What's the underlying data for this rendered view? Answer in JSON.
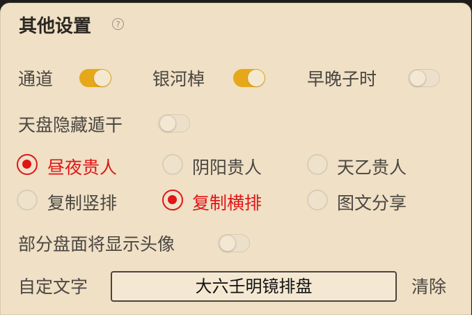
{
  "section": {
    "title": "其他设置",
    "help_icon": "?"
  },
  "toggles_row1": [
    {
      "label": "通道",
      "on": true
    },
    {
      "label": "银河棹",
      "on": true
    },
    {
      "label": "早晚子时",
      "on": false
    }
  ],
  "toggle_tianpan": {
    "label": "天盘隐藏遁干",
    "on": false
  },
  "radio_group1": {
    "options": [
      "昼夜贵人",
      "阴阳贵人",
      "天乙贵人"
    ],
    "selected": "昼夜贵人"
  },
  "radio_group2": {
    "options": [
      "复制竖排",
      "复制横排",
      "图文分享"
    ],
    "selected": "复制横排"
  },
  "toggle_avatar": {
    "label": "部分盘面将显示头像",
    "on": false
  },
  "custom_text": {
    "label": "自定文字",
    "value": "大六壬明镜排盘",
    "clear_label": "清除"
  },
  "colors": {
    "accent_toggle": "#e6a81a",
    "selected_radio": "#e01515",
    "panel_bg": "#efe0c6"
  }
}
